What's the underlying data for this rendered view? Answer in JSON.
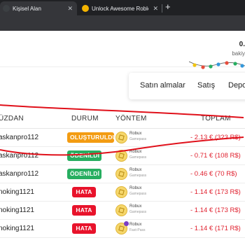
{
  "browser": {
    "tabs": [
      {
        "title": "Kişisel Alan",
        "active": true
      },
      {
        "title": "Unlock Awesome Roblox Skins",
        "active": false
      }
    ],
    "new_tab": "+",
    "close_glyph": "✕"
  },
  "header": {
    "balance": "0.",
    "balance_label": "bakiy"
  },
  "nav": {
    "purchases": "Satın almalar",
    "sales": "Satış",
    "deposit": "Depo"
  },
  "table": {
    "headers": {
      "kimden": "ÜZDAN",
      "durum": "DURUM",
      "yontem": "YÖNTEM",
      "toplam": "TOPLAM"
    },
    "rows": [
      {
        "user": "askanpro112",
        "status": "OLUŞTURULDU",
        "status_type": "created",
        "method": "Robux",
        "method_sub": "Gamepass",
        "total": "- 2.13 € (323 R$)"
      },
      {
        "user": "askanpro112",
        "status": "ÖDENİLDİ",
        "status_type": "paid",
        "method": "Robux",
        "method_sub": "Gamepass",
        "total": "- 0.71 € (108 R$)"
      },
      {
        "user": "askanpro112",
        "status": "ÖDENİLDİ",
        "status_type": "paid",
        "method": "Robux",
        "method_sub": "Gamepass",
        "total": "- 0.46 € (70 R$)"
      },
      {
        "user": "noking1121",
        "status": "HATA",
        "status_type": "error",
        "method": "Robux",
        "method_sub": "Gamepass",
        "total": "- 1.14 € (173 R$)"
      },
      {
        "user": "noking1121",
        "status": "HATA",
        "status_type": "error",
        "method": "Robux",
        "method_sub": "Gamepass",
        "total": "- 1.14 € (173 R$)"
      },
      {
        "user": "noking1121",
        "status": "HATA",
        "status_type": "error",
        "method": "Robux",
        "method_sub": "Fast-Pass",
        "total": "- 1.14 € (171 R$)"
      }
    ]
  },
  "colors": {
    "created": "#f39c12",
    "paid": "#27ae60",
    "error": "#e8132b",
    "total": "#e0202e",
    "annotation": "#e0101a"
  }
}
